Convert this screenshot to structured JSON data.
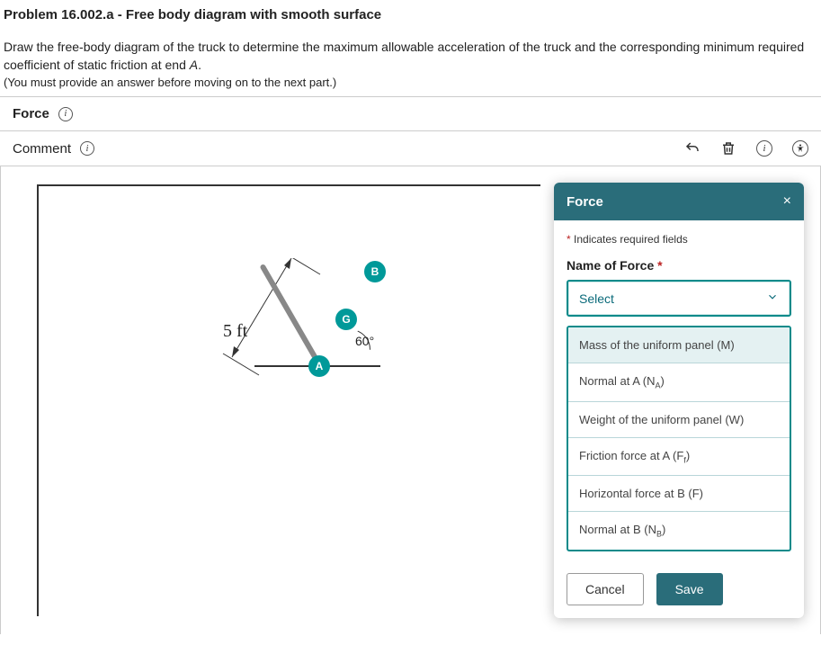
{
  "problem": {
    "title": "Problem 16.002.a - Free body diagram with smooth surface",
    "description_part1": "Draw the free-body diagram of the truck to determine the maximum allowable acceleration of the truck and the corresponding minimum required coefficient of static friction at end ",
    "description_em": "A",
    "description_part2": ".",
    "note": "(You must provide an answer before moving on to the next part.)"
  },
  "tabs": {
    "force": "Force",
    "comment": "Comment"
  },
  "diagram": {
    "length_label": "5 ft",
    "angle_label": "60°",
    "nodes": {
      "a": "A",
      "g": "G",
      "b": "B"
    }
  },
  "panel": {
    "title": "Force",
    "required_note": "Indicates required fields",
    "field_label": "Name of Force",
    "select_placeholder": "Select",
    "options": [
      "Mass of the uniform panel (M)",
      "Normal at A (N_A)",
      "Weight of the uniform panel (W)",
      "Friction force at A (F_f)",
      "Horizontal force at B (F)",
      "Normal at B (N_B)"
    ],
    "cancel": "Cancel",
    "save": "Save"
  }
}
